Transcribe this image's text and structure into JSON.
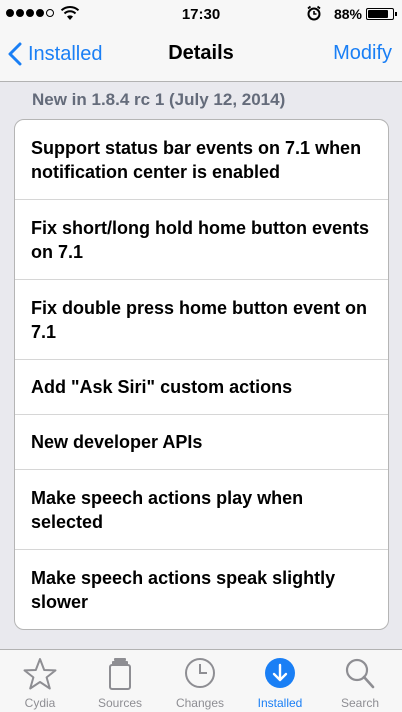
{
  "status_bar": {
    "time": "17:30",
    "battery_percent": "88%",
    "battery_level": 0.88,
    "signal_bars_filled": 4,
    "signal_bars_total": 5
  },
  "nav": {
    "back_label": "Installed",
    "title": "Details",
    "action_label": "Modify"
  },
  "section": {
    "header": "New in 1.8.4 rc 1 (July 12, 2014)"
  },
  "changes": [
    "Support status bar events on 7.1 when notification center is enabled",
    "Fix short/long hold home button events on 7.1",
    "Fix double press home button event on 7.1",
    "Add \"Ask Siri\" custom actions",
    "New developer APIs",
    "Make speech actions play when selected",
    "Make speech actions speak slightly slower"
  ],
  "tabs": [
    {
      "label": "Cydia",
      "icon": "star-icon"
    },
    {
      "label": "Sources",
      "icon": "sources-icon"
    },
    {
      "label": "Changes",
      "icon": "clock-icon"
    },
    {
      "label": "Installed",
      "icon": "download-icon",
      "active": true
    },
    {
      "label": "Search",
      "icon": "search-icon"
    }
  ],
  "colors": {
    "accent": "#1a7ff5",
    "inactive": "#8e8e93",
    "section_header": "#646b7a"
  }
}
